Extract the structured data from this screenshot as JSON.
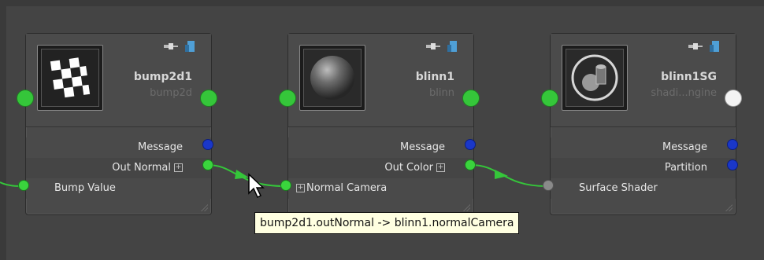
{
  "nodes": [
    {
      "title": "bump2d1",
      "subtitle": "bump2d",
      "outputs": [
        {
          "label": "Message",
          "color": "#1a37c9"
        },
        {
          "label": "Out Normal",
          "color": "#3ad43d",
          "expander": "+"
        }
      ],
      "inputs": [
        {
          "label": "Bump Value",
          "color": "#3ad43d"
        }
      ]
    },
    {
      "title": "blinn1",
      "subtitle": "blinn",
      "outputs": [
        {
          "label": "Message",
          "color": "#1a37c9"
        },
        {
          "label": "Out Color",
          "color": "#3ad43d",
          "expander": "+"
        }
      ],
      "inputs": [
        {
          "label": "Normal Camera",
          "color": "#3ad43d",
          "expander": "+"
        }
      ]
    },
    {
      "title": "blinn1SG",
      "subtitle": "shadi...ngine",
      "outputs": [
        {
          "label": "Message",
          "color": "#1a37c9"
        },
        {
          "label": "Partition",
          "color": "#1a37c9"
        }
      ],
      "inputs": [
        {
          "label": "Surface Shader",
          "color": "#8a8a8a"
        }
      ]
    }
  ],
  "tooltip": "bump2d1.outNormal -> blinn1.normalCamera",
  "icons": [
    "checker-swatch-icon",
    "sphere-swatch-icon",
    "shading-group-swatch-icon",
    "pin-icon",
    "cube-icon",
    "resize-grip-icon",
    "cursor-arrow-icon"
  ]
}
